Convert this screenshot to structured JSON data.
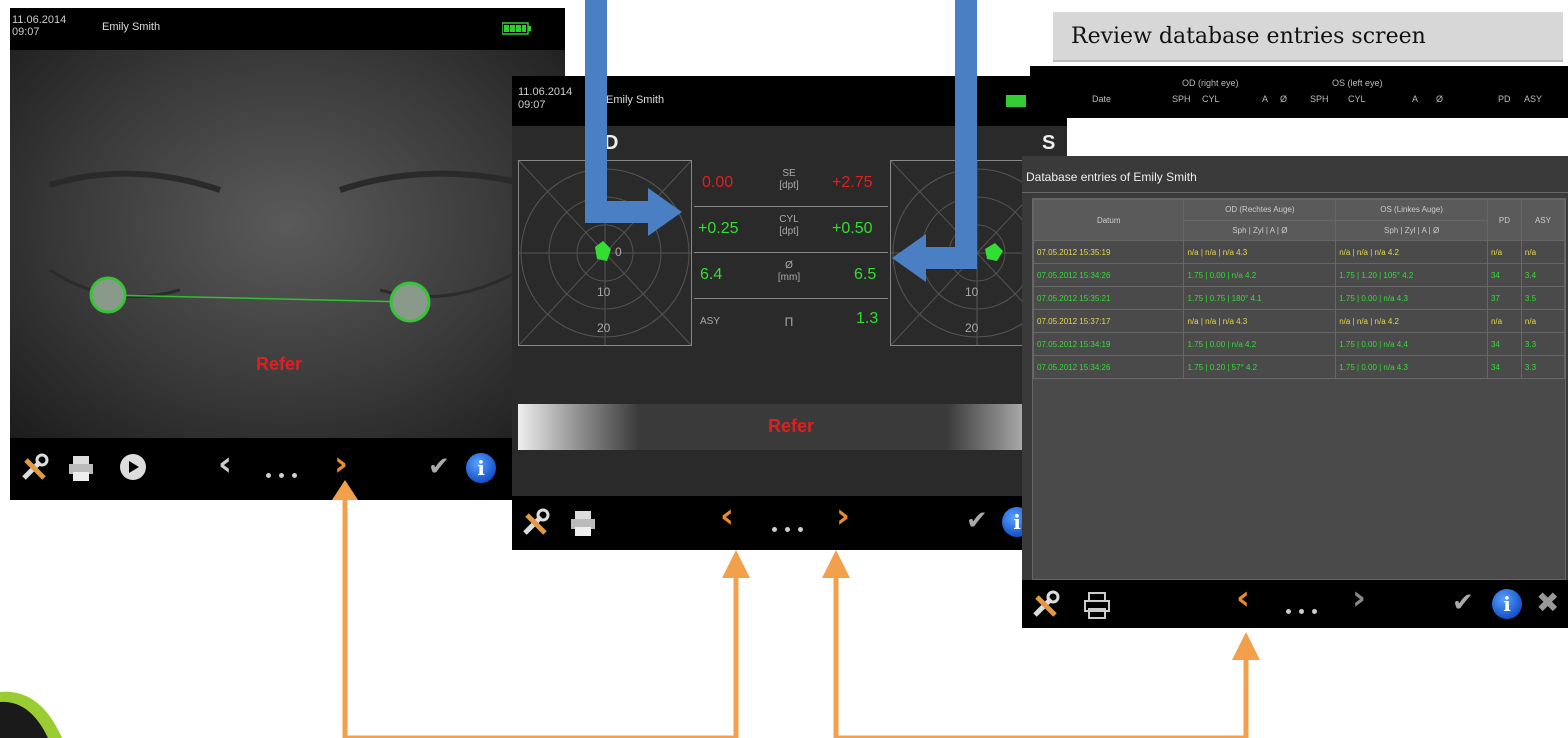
{
  "colors": {
    "arrow_blue": "#4a7fc4",
    "arrow_orange": "#f3a04c",
    "green": "#33dd33",
    "red": "#e02020",
    "yellow": "#e6d84a"
  },
  "screen1": {
    "date": "11.06.2014",
    "time": "09:07",
    "patient": "Emily Smith",
    "battery_icon": "battery-icon",
    "result": "Refer",
    "toolbar": {
      "tools_icon": "tools-icon",
      "print_icon": "print-icon",
      "play_icon": "play-icon",
      "prev_icon": "chevron-left-icon",
      "next_icon": "chevron-right-icon",
      "check_icon": "check-icon",
      "info_icon": "info-icon",
      "info_label": "i"
    }
  },
  "screen2": {
    "date": "11.06.2014",
    "time": "09:07",
    "patient": "Emily Smith",
    "od_label": "D",
    "os_label": "S",
    "polar_labels": [
      "0",
      "10",
      "20"
    ],
    "rows": [
      {
        "left": "0.00",
        "label": "SE\n[dpt]",
        "right": "+2.75",
        "left_color": "#e02020",
        "right_color": "#e02020"
      },
      {
        "left": "+0.25",
        "label": "CYL\n[dpt]",
        "right": "+0.50",
        "left_color": "#33dd33",
        "right_color": "#33dd33"
      },
      {
        "left": "6.4",
        "label": "Ø\n[mm]",
        "right": "6.5",
        "left_color": "#33dd33",
        "right_color": "#33dd33"
      },
      {
        "left": "ASY",
        "label": "Π",
        "right": "1.3",
        "left_color": "#aaaaaa",
        "right_color": "#33dd33"
      }
    ],
    "result": "Refer",
    "toolbar": {
      "tools_icon": "tools-icon",
      "print_icon": "print-icon",
      "prev_icon": "chevron-left-icon",
      "next_icon": "chevron-right-icon",
      "check_icon": "check-icon",
      "info_icon": "info-icon",
      "info_label": "i"
    }
  },
  "screen3": {
    "caption": "Review database entries screen",
    "zoom_header": {
      "od": "OD (right eye)",
      "os": "OS (left eye)",
      "cols": [
        "Date",
        "SPH",
        "CYL",
        "A",
        "Ø",
        "SPH",
        "CYL",
        "A",
        "Ø",
        "PD",
        "ASY"
      ]
    },
    "title": "Database entries of Emily Smith",
    "table": {
      "col_header": "Datum",
      "od_header": "OD (Rechtes Auge)",
      "os_header": "OS (Linkes Auge)",
      "sub_od": "Sph | Zyl | A | Ø",
      "sub_os": "Sph | Zyl | A | Ø",
      "pd": "PD",
      "asy": "ASY",
      "rows": [
        {
          "date": "07.05.2012 15:35:19",
          "od": "n/a | n/a | n/a 4.3",
          "os": "n/a | n/a | n/a 4.2",
          "pd": "n/a",
          "asy": "n/a",
          "color": "#e6d84a"
        },
        {
          "date": "07.05.2012 15:34:26",
          "od": "1.75 | 0.00 | n/a 4.2",
          "os": "1.75 | 1.20 | 105° 4.2",
          "pd": "34",
          "asy": "3.4",
          "color": "#33dd33"
        },
        {
          "date": "07.05.2012 15:35:21",
          "od": "1.75 | 0.75 | 180° 4.1",
          "os": "1.75 | 0.00 | n/a 4.3",
          "pd": "37",
          "asy": "3.5",
          "color": "#33dd33"
        },
        {
          "date": "07.05.2012 15:37:17",
          "od": "n/a | n/a | n/a 4.3",
          "os": "n/a | n/a | n/a 4.2",
          "pd": "n/a",
          "asy": "n/a",
          "color": "#e6d84a"
        },
        {
          "date": "07.05.2012 15:34:19",
          "od": "1.75 | 0.00 | n/a 4.2",
          "os": "1.75 | 0.00 | n/a 4.4",
          "pd": "34",
          "asy": "3.3",
          "color": "#33dd33"
        },
        {
          "date": "07.05.2012 15:34:26",
          "od": "1.75 | 0.20 | 57° 4.2",
          "os": "1.75 | 0.00 | n/a 4.3",
          "pd": "34",
          "asy": "3.3",
          "color": "#33dd33"
        }
      ]
    },
    "toolbar": {
      "tools_icon": "tools-icon",
      "print_icon": "print-icon",
      "prev_icon": "chevron-left-icon",
      "next_icon": "chevron-right-icon",
      "check_icon": "check-icon",
      "info_icon": "info-icon",
      "info_label": "i",
      "close_icon": "close-icon"
    }
  }
}
